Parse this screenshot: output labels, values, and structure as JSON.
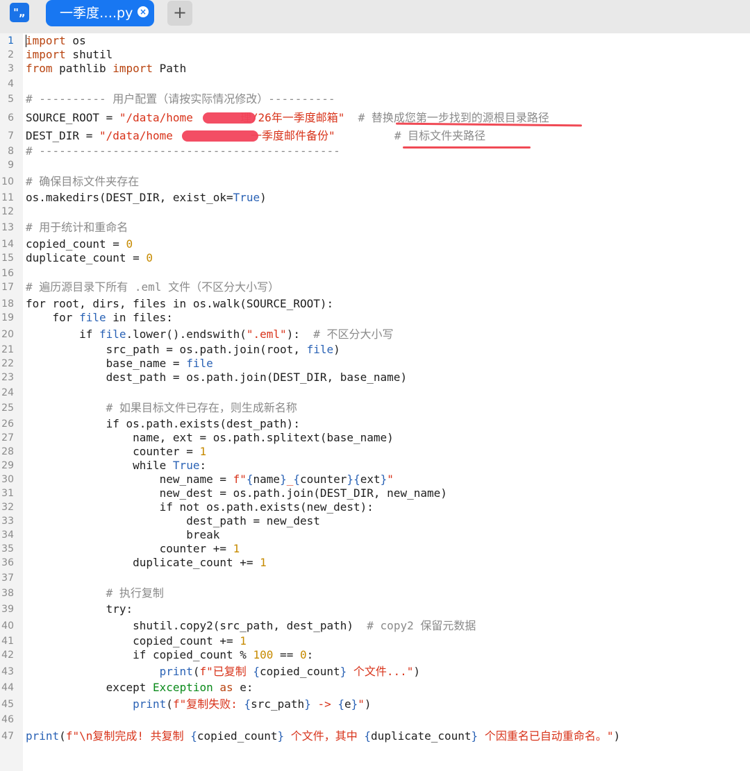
{
  "app": {
    "icon_glyph": "\"„"
  },
  "tab": {
    "label": "一季度….py",
    "close_glyph": "×"
  },
  "new_tab_glyph": "+",
  "line_numbers": [
    "1",
    "2",
    "3",
    "4",
    "5",
    "6",
    "7",
    "8",
    "9",
    "10",
    "11",
    "12",
    "13",
    "14",
    "15",
    "16",
    "17",
    "18",
    "19",
    "20",
    "21",
    "22",
    "23",
    "24",
    "25",
    "26",
    "27",
    "28",
    "29",
    "30",
    "31",
    "32",
    "33",
    "34",
    "35",
    "36",
    "37",
    "38",
    "39",
    "40",
    "41",
    "42",
    "43",
    "44",
    "45",
    "46",
    "47"
  ],
  "active_line": 1,
  "code": {
    "l1_kw": "import",
    "l1_rest": " os",
    "l2_kw": "import",
    "l2_rest": " shutil",
    "l3_kw1": "from",
    "l3_mid": " pathlib ",
    "l3_kw2": "import",
    "l3_rest": " Path",
    "l5_comment": "# ---------- 用户配置（请按实际情况修改）----------",
    "l6_lhs": "SOURCE_ROOT = ",
    "l6_str1": "\"/data/home",
    "l6_str2": "理/26年一季度邮箱\"",
    "l6_comment": "  # 替换成您第一步找到的源根目录路径",
    "l7_lhs": "DEST_DIR = ",
    "l7_str1": "\"/data/home",
    "l7_str2": "一季度邮件备份\"",
    "l7_comment": "  # 目标文件夹路径",
    "l8_comment": "# ---------------------------------------------",
    "l10_comment": "# 确保目标文件夹存在",
    "l11_a": "os.makedirs(DEST_DIR, exist_ok=",
    "l11_true": "True",
    "l11_b": ")",
    "l13_comment": "# 用于统计和重命名",
    "l14_a": "copied_count = ",
    "l14_num": "0",
    "l15_a": "duplicate_count = ",
    "l15_num": "0",
    "l17_comment": "# 遍历源目录下所有 .eml 文件（不区分大小写）",
    "l18": "for root, dirs, files in os.walk(SOURCE_ROOT):",
    "l19_a": "    for ",
    "l19_file": "file",
    "l19_b": " in files:",
    "l20_a": "        if ",
    "l20_file": "file",
    "l20_b": ".lower().endswith(",
    "l20_str": "\".eml\"",
    "l20_c": "):",
    "l20_comment": "  # 不区分大小写",
    "l21_a": "            src_path = os.path.join(root, ",
    "l21_file": "file",
    "l21_b": ")",
    "l22_a": "            base_name = ",
    "l22_file": "file",
    "l23": "            dest_path = os.path.join(DEST_DIR, base_name)",
    "l25_comment": "            # 如果目标文件已存在，则生成新名称",
    "l26": "            if os.path.exists(dest_path):",
    "l27": "                name, ext = os.path.splitext(base_name)",
    "l28_a": "                counter = ",
    "l28_num": "1",
    "l29_a": "                while ",
    "l29_true": "True",
    "l29_b": ":",
    "l30_a": "                    new_name = ",
    "l30_s1": "f\"",
    "l30_b1": "{",
    "l30_v1": "name",
    "l30_b2": "}",
    "l30_s2": "_",
    "l30_b3": "{",
    "l30_v2": "counter",
    "l30_b4": "}",
    "l30_b5": "{",
    "l30_v3": "ext",
    "l30_b6": "}",
    "l30_s3": "\"",
    "l31": "                    new_dest = os.path.join(DEST_DIR, new_name)",
    "l32": "                    if not os.path.exists(new_dest):",
    "l33": "                        dest_path = new_dest",
    "l34": "                        break",
    "l35_a": "                    counter += ",
    "l35_num": "1",
    "l36_a": "                duplicate_count += ",
    "l36_num": "1",
    "l38_comment": "            # 执行复制",
    "l39": "            try:",
    "l40_a": "                shutil.copy2(src_path, dest_path)",
    "l40_comment": "  # copy2 保留元数据",
    "l41_a": "                copied_count += ",
    "l41_num": "1",
    "l42_a": "                if copied_count % ",
    "l42_num1": "100",
    "l42_b": " == ",
    "l42_num2": "0",
    "l42_c": ":",
    "l43_ind": "                    ",
    "l43_fn": "print",
    "l43_a": "(",
    "l43_s1": "f\"已复制 ",
    "l43_b1": "{",
    "l43_v": "copied_count",
    "l43_b2": "}",
    "l43_s2": " 个文件...\"",
    "l43_c": ")",
    "l44_a": "            except ",
    "l44_cls": "Exception",
    "l44_b": " ",
    "l44_as": "as",
    "l44_c": " e:",
    "l45_ind": "                ",
    "l45_fn": "print",
    "l45_a": "(",
    "l45_s1": "f\"复制失败: ",
    "l45_b1": "{",
    "l45_v1": "src_path",
    "l45_b2": "}",
    "l45_s2": " -> ",
    "l45_b3": "{",
    "l45_v2": "e",
    "l45_b4": "}",
    "l45_s3": "\"",
    "l45_c": ")",
    "l47_fn": "print",
    "l47_a": "(",
    "l47_s1": "f\"\\n复制完成! 共复制 ",
    "l47_b1": "{",
    "l47_v1": "copied_count",
    "l47_b2": "}",
    "l47_s2": " 个文件，其中 ",
    "l47_b3": "{",
    "l47_v2": "duplicate_count",
    "l47_b4": "}",
    "l47_s3": " 个因重名已自动重命名。\"",
    "l47_c": ")"
  }
}
